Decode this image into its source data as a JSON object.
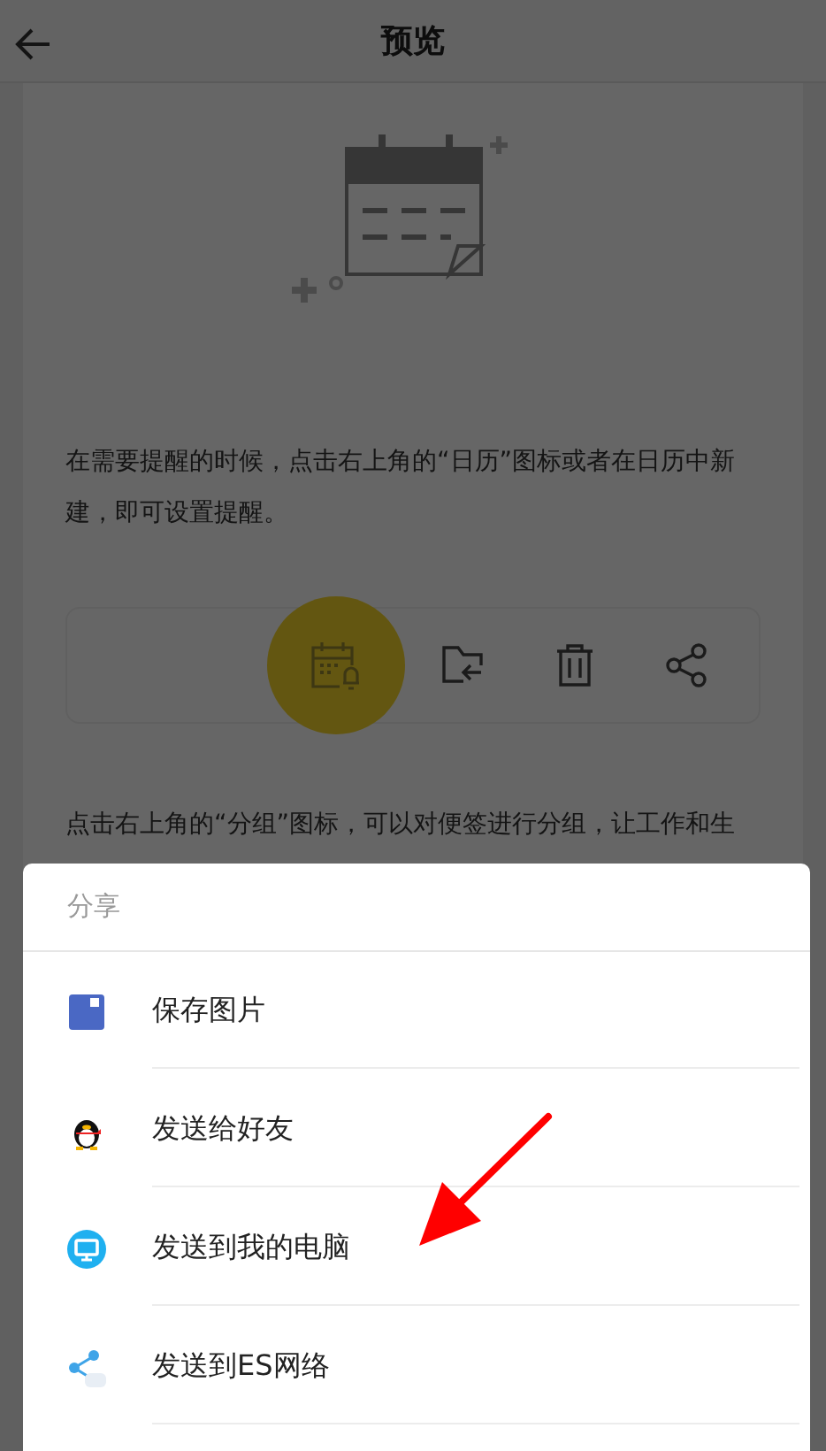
{
  "header": {
    "title": "预览"
  },
  "note": {
    "paragraphs": [
      "在需要提醒的时候，点击右上角的“日历”图标或者在日历中新建，即可设置提醒。",
      "点击右上角的“分组”图标，可以对便签进行分组，让工作和生"
    ]
  },
  "share_sheet": {
    "title": "分享",
    "items": [
      {
        "label": "保存图片"
      },
      {
        "label": "发送给好友"
      },
      {
        "label": "发送到我的电脑"
      },
      {
        "label": "发送到ES网络"
      }
    ]
  }
}
